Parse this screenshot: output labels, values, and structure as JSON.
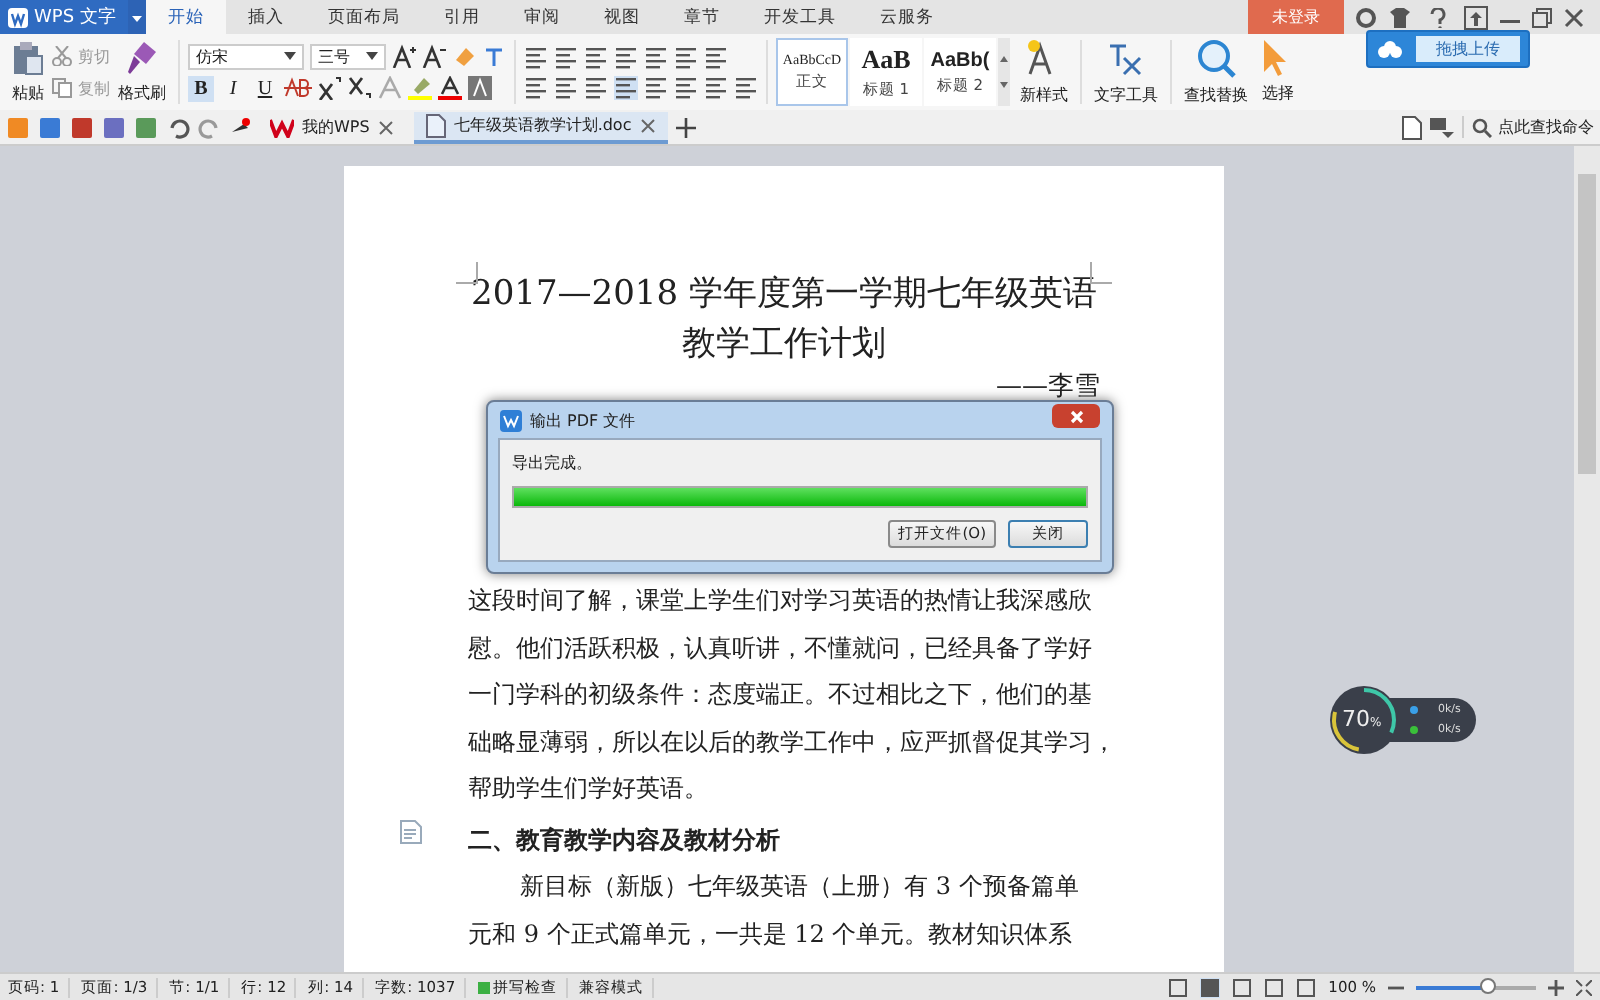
{
  "app": {
    "logo": "WPS 文字",
    "login": "未登录",
    "upload_tip": "拖拽上传"
  },
  "menu_tabs": [
    {
      "label": "开始",
      "selected": true
    },
    {
      "label": "插入",
      "selected": false
    },
    {
      "label": "页面布局",
      "selected": false
    },
    {
      "label": "引用",
      "selected": false
    },
    {
      "label": "审阅",
      "selected": false
    },
    {
      "label": "视图",
      "selected": false
    },
    {
      "label": "章节",
      "selected": false
    },
    {
      "label": "开发工具",
      "selected": false
    },
    {
      "label": "云服务",
      "selected": false
    }
  ],
  "ribbon": {
    "paste": "粘贴",
    "cut": "剪切",
    "copy": "复制",
    "format_painter": "格式刷",
    "font": "仿宋",
    "size": "三号",
    "format_buttons": [
      "B",
      "I",
      "U"
    ],
    "styles": [
      {
        "sample": "AaBbCcD",
        "label": "正文",
        "selected": true
      },
      {
        "sample": "AaB",
        "label": "标题 1",
        "selected": false
      },
      {
        "sample": "AaBb(",
        "label": "标题 2",
        "selected": false
      }
    ],
    "tools": [
      {
        "kind": "style",
        "label": "新样式"
      },
      {
        "kind": "text",
        "label": "文字工具"
      },
      {
        "kind": "find",
        "label": "查找替换"
      },
      {
        "kind": "select",
        "label": "选择"
      }
    ],
    "search": "点此查找命令"
  },
  "doc_tabs": [
    {
      "label": "我的WPS",
      "kind": "home",
      "selected": false
    },
    {
      "label": "七年级英语教学计划.doc",
      "kind": "doc",
      "selected": true
    }
  ],
  "document": {
    "title": "2017—2018 学年度第一学期七年级英语教学工作计划",
    "author": "——李雪",
    "blocks": [
      {
        "kind": "line",
        "text": "这段时间了解，课堂上学生们对学习英语的热情让我深感欣"
      },
      {
        "kind": "line",
        "text": "慰。他们活跃积极，认真听讲，不懂就问，已经具备了学好"
      },
      {
        "kind": "line",
        "text": "一门学科的初级条件：态度端正。不过相比之下，他们的基"
      },
      {
        "kind": "line",
        "text": "础略显薄弱，所以在以后的教学工作中，应严抓督促其学习，"
      },
      {
        "kind": "line",
        "text": "帮助学生们学好英语。"
      },
      {
        "kind": "heading",
        "text": "二、教育教学内容及教材分析"
      },
      {
        "kind": "indent",
        "text": "新目标（新版）七年级英语（上册）有 3 个预备篇单"
      },
      {
        "kind": "line",
        "text": "元和 9 个正式篇单元，一共是 12 个单元。教材知识体系"
      }
    ]
  },
  "dialog": {
    "title": "输出 PDF 文件",
    "message": "导出完成。",
    "level": 1.0,
    "buttons": [
      "打开文件(O)",
      "关闭"
    ]
  },
  "net_widget": {
    "percent": "70",
    "unit": "%",
    "up": "0k/s",
    "down": "0k/s"
  },
  "status_bar": {
    "items": [
      "页码: 1",
      "页面: 1/3",
      "节: 1/1",
      "行: 12",
      "列: 14",
      "字数: 1037"
    ],
    "spell": "拼写检查",
    "mode": "兼容模式",
    "zoom": "100 %",
    "zoom_level": {
      "level": 0.6
    }
  }
}
